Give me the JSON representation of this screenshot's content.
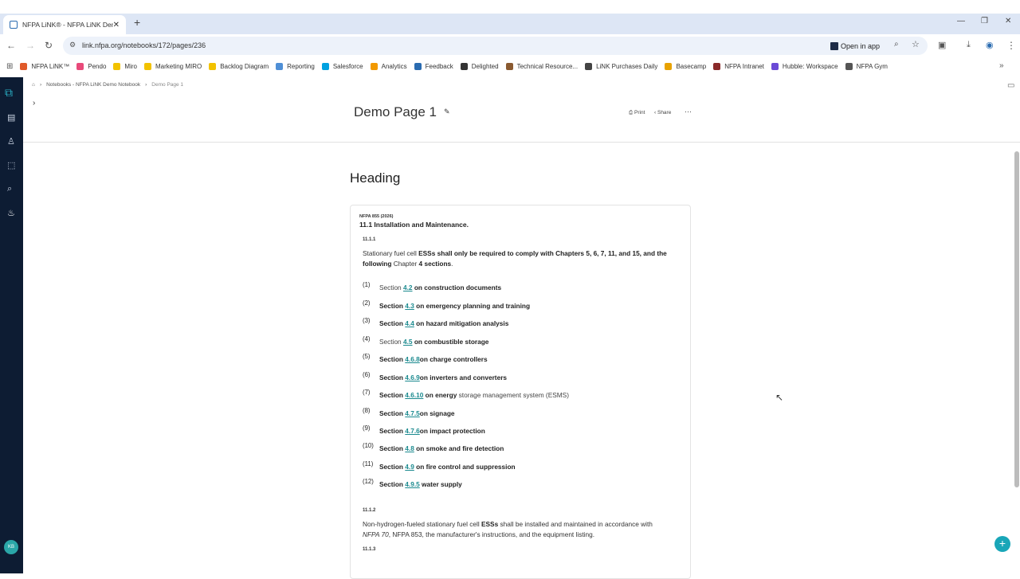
{
  "browser": {
    "tab_title": "NFPA LiNK® - NFPA LiNK Demo",
    "url": "link.nfpa.org/notebooks/172/pages/236",
    "open_in_app": "Open in app"
  },
  "bookmarks": [
    "NFPA LiNK™",
    "Pendo",
    "Miro",
    "Marketing MIRO",
    "Backlog Diagram",
    "Reporting",
    "Salesforce",
    "Analytics",
    "Feedback",
    "Delighted",
    "Technical Resource...",
    "LiNK Purchases Daily",
    "Basecamp",
    "NFPA Intranet",
    "Hubble: Workspace",
    "NFPA Gym"
  ],
  "bookmark_colors": [
    "#e05a2a",
    "#e84a7a",
    "#f2c200",
    "#f2c200",
    "#f2c200",
    "#4f8fd6",
    "#00a1e0",
    "#f29900",
    "#2a6bb0",
    "#333333",
    "#8a5a30",
    "#444444",
    "#e8a200",
    "#8a2a2a",
    "#6a4ad6",
    "#555555"
  ],
  "breadcrumb": {
    "home": "⌂",
    "notebook": "Notebooks - NFPA LiNK Demo Notebook",
    "page": "Demo Page 1"
  },
  "page": {
    "title": "Demo Page 1",
    "print": "Print",
    "share": "Share",
    "heading": "Heading"
  },
  "content": {
    "source": "NFPA 855 (2026)",
    "section_title": "11.1 Installation and Maintenance.",
    "p1_num": "11.1.1",
    "p1_a": "Stationary fuel cell ",
    "p1_b": "ESSs shall only be required to comply with Chapters 5, 6, 7, 11, and 15, and the following",
    "p1_c": " Chapter ",
    "p1_d": "4 sections",
    "p1_e": ".",
    "items": [
      {
        "n": "(1)",
        "pre": "Section ",
        "link": "4.2",
        "post": " on construction documents",
        "light": true
      },
      {
        "n": "(2)",
        "pre": "Section ",
        "link": "4.3",
        "post": " on emergency planning and training",
        "light": false
      },
      {
        "n": "(3)",
        "pre": "Section ",
        "link": "4.4",
        "post": " on hazard mitigation analysis",
        "light": false
      },
      {
        "n": "(4)",
        "pre": "Section ",
        "link": "4.5",
        "post": " on combustible storage",
        "light": true
      },
      {
        "n": "(5)",
        "pre": "Section ",
        "link": "4.6.8",
        "post": "on charge controllers",
        "light": false
      },
      {
        "n": "(6)",
        "pre": "Section ",
        "link": "4.6.9",
        "post": "on inverters and converters",
        "light": false
      },
      {
        "n": "(7)",
        "pre": "Section ",
        "link": "4.6.10",
        "post": " on energy",
        "post_light": " storage management system (ESMS)",
        "light": false
      },
      {
        "n": "(8)",
        "pre": "Section ",
        "link": "4.7.5",
        "post": "on signage",
        "light": false
      },
      {
        "n": "(9)",
        "pre": "Section ",
        "link": "4.7.6",
        "post": "on impact protection",
        "light": false
      },
      {
        "n": "(10)",
        "pre": "Section ",
        "link": "4.8",
        "post": " on smoke and fire detection",
        "light": false
      },
      {
        "n": "(11)",
        "pre": "Section ",
        "link": "4.9",
        "post": " on fire control and suppression",
        "light": false
      },
      {
        "n": "(12)",
        "pre": "Section ",
        "link": "4.9.5",
        "post": " water supply",
        "light": false
      }
    ],
    "p2_num": "11.1.2",
    "p2_a": "Non-hydrogen-fueled stationary fuel cell ",
    "p2_b": "ESSs",
    "p2_c": " shall be installed and maintained in accordance with",
    "p2_d": "NFPA 70",
    "p2_e": ", NFPA 853, the manufacturer's instructions, and the equipment listing.",
    "p3_num": "11.1.3"
  },
  "user": {
    "initials": "KB"
  }
}
